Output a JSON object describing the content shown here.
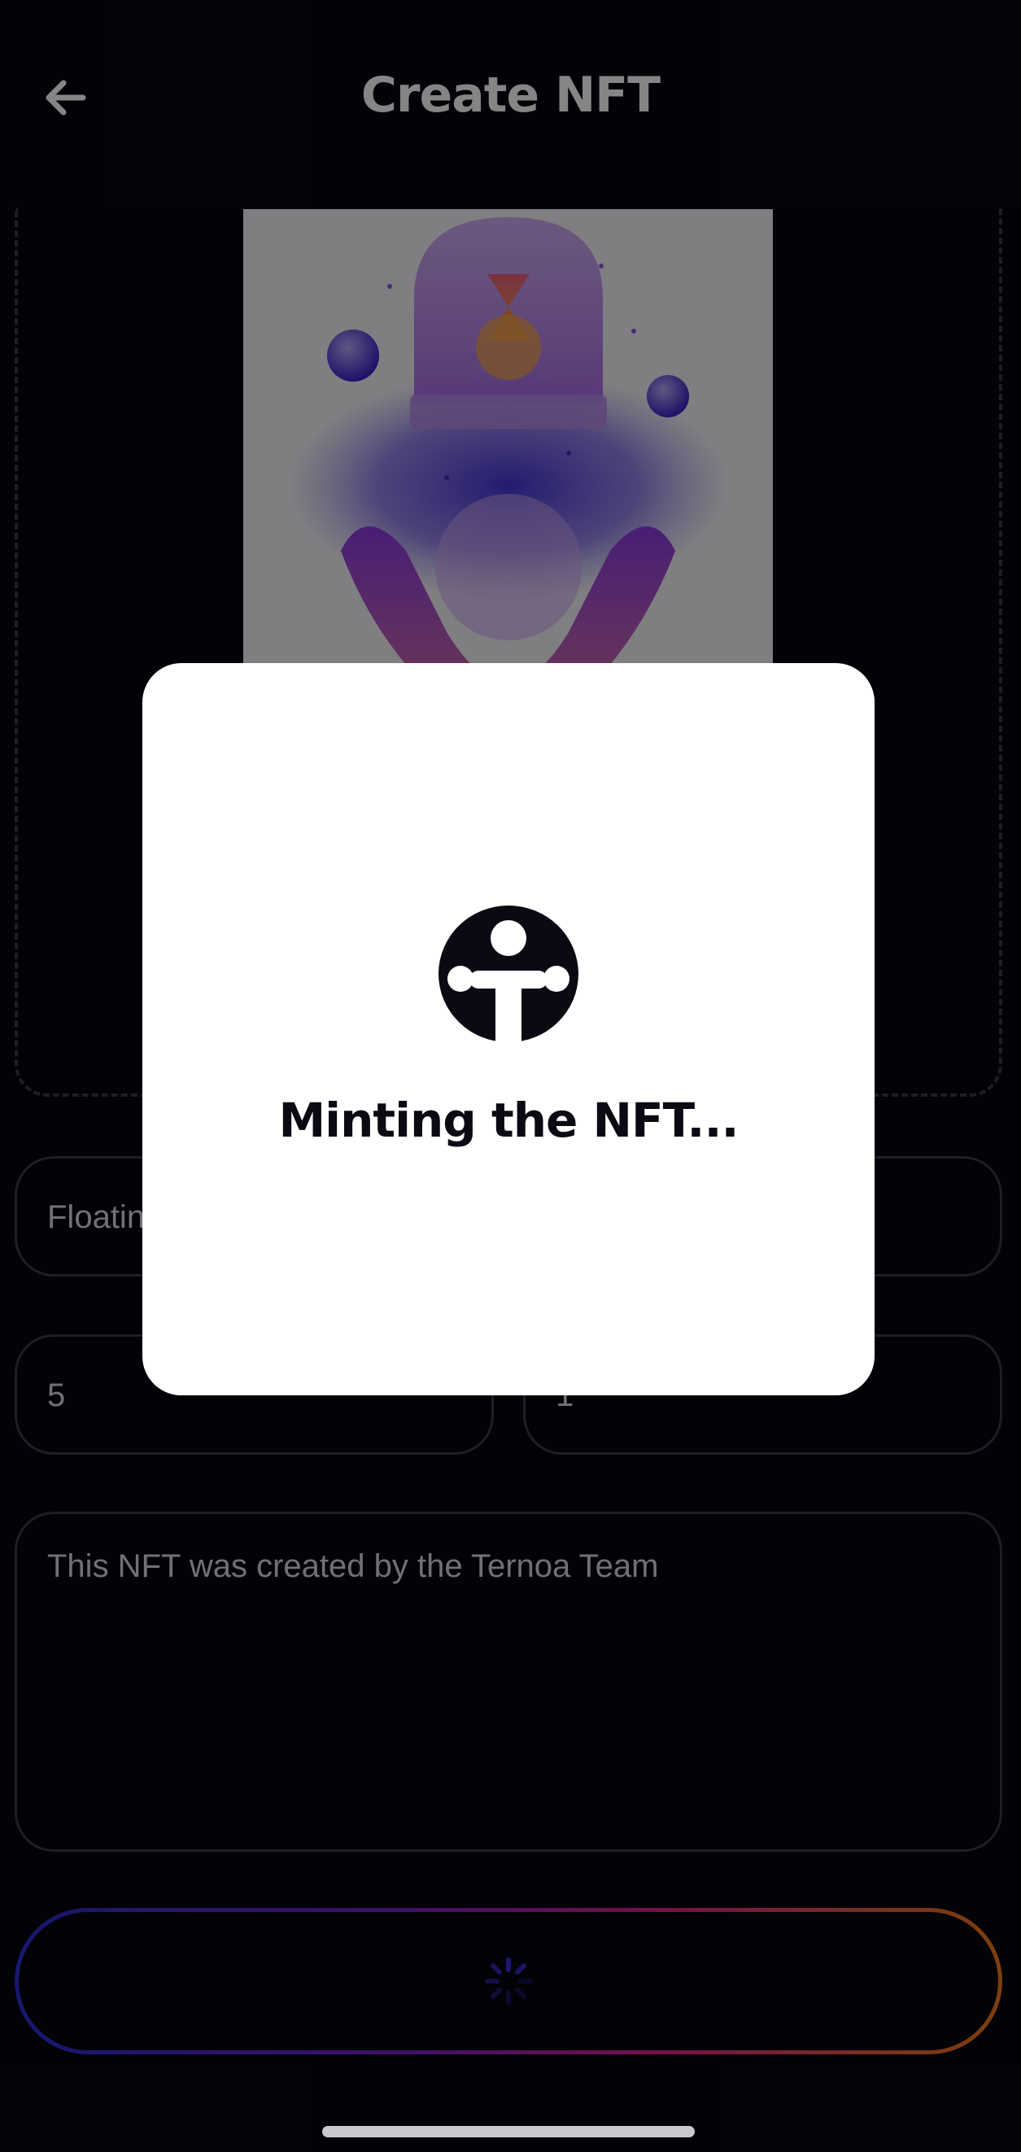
{
  "header": {
    "title": "Create NFT",
    "back_icon": "arrow-left-icon"
  },
  "form": {
    "name_value": "Floatin",
    "royalty_value": "5",
    "quantity_value": "1",
    "description_value": "This NFT was created by the Ternoa Team"
  },
  "submit": {
    "icon": "loading-spinner-icon"
  },
  "modal": {
    "logo": "ternoa-logo-icon",
    "message": "Minting the NFT..."
  },
  "colors": {
    "background": "#05050f",
    "field_border": "#3a3b4d",
    "gradient_start": "#2b2fd4",
    "gradient_end": "#f07a18",
    "modal_bg": "#ffffff"
  }
}
